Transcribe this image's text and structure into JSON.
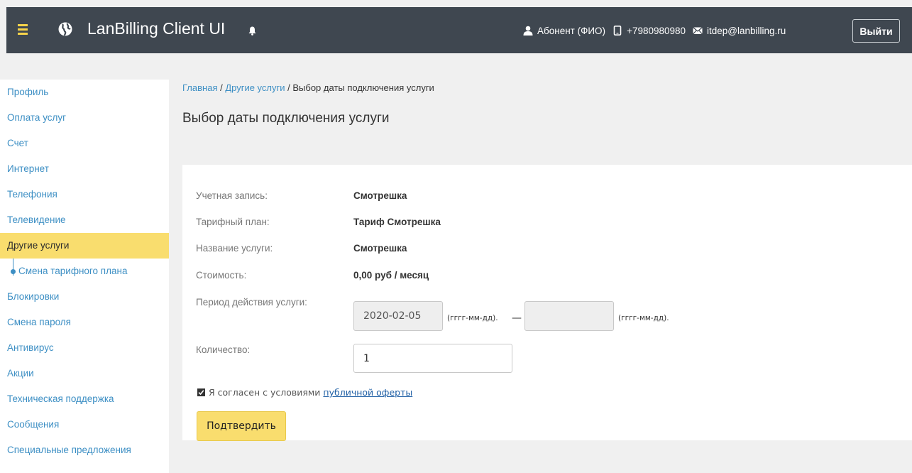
{
  "header": {
    "app_title": "LanBilling Client UI",
    "user_name": "Абонент (ФИО)",
    "phone": "+7980980980",
    "email": "itdep@lanbilling.ru",
    "logout_label": "Выйти"
  },
  "sidebar": {
    "items": [
      {
        "label": "Профиль"
      },
      {
        "label": "Оплата услуг"
      },
      {
        "label": "Счет"
      },
      {
        "label": "Интернет"
      },
      {
        "label": "Телефония"
      },
      {
        "label": "Телевидение"
      },
      {
        "label": "Другие услуги",
        "active": true
      },
      {
        "label": "Смена тарифного плана",
        "sub": true
      },
      {
        "label": "Блокировки"
      },
      {
        "label": "Смена пароля"
      },
      {
        "label": "Антивирус"
      },
      {
        "label": "Акции"
      },
      {
        "label": "Техническая поддержка"
      },
      {
        "label": "Сообщения"
      },
      {
        "label": "Специальные предложения"
      }
    ]
  },
  "breadcrumb": {
    "home": "Главная",
    "sep1": " / ",
    "section": "Другие услуги",
    "sep2": " / ",
    "current": "Выбор даты подключения услуги"
  },
  "page": {
    "title": "Выбор даты подключения услуги"
  },
  "form": {
    "account_label": "Учетная запись:",
    "account_value": "Смотрешка",
    "tariff_label": "Тарифный план:",
    "tariff_value": "Тариф Смотрешка",
    "service_label": "Название услуги:",
    "service_value": "Смотрешка",
    "cost_label": "Стоимость:",
    "cost_value": "0,00  руб / месяц",
    "period_label": "Период действия услуги:",
    "period_start": "2020-02-05",
    "period_end": "",
    "date_hint": "(гггг-мм-дд).",
    "date_separator": "—",
    "quantity_label": "Количество:",
    "quantity_value": "1",
    "agree_text": "Я согласен с условиями",
    "agree_link": "публичной оферты",
    "agree_checked": true,
    "confirm_label": "Подтвердить"
  },
  "colors": {
    "topbar": "#3f4750",
    "accent_yellow": "#f9dd6e",
    "link_blue": "#3d8fc4"
  }
}
